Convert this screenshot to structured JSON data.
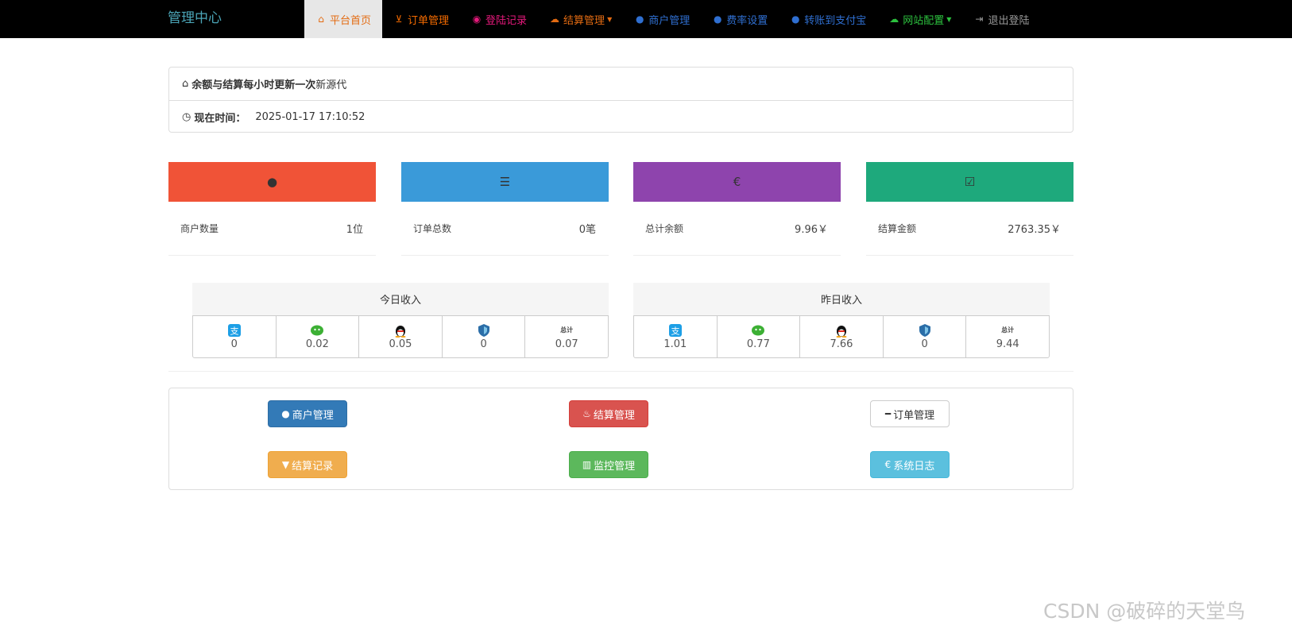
{
  "colors": {
    "nav_bg": "#000000",
    "brand": "#4ba5b7",
    "card_users": "#f05337",
    "card_orders": "#3a9ad9",
    "card_balance": "#8e44ad",
    "card_settled": "#1ea97c"
  },
  "nav": {
    "brand": "管理中心",
    "items": [
      {
        "label": "平台首页",
        "icon": "home-icon",
        "glyph": "⌂",
        "color": "#e36b12",
        "active": true
      },
      {
        "label": "订单管理",
        "icon": "cart-icon",
        "glyph": "🛒",
        "color": "#f56b00"
      },
      {
        "label": "登陆记录",
        "icon": "camera-icon",
        "glyph": "◉",
        "color": "#e5197b"
      },
      {
        "label": "结算管理",
        "icon": "cloud-icon",
        "glyph": "☁",
        "color": "#e36b12",
        "caret": true
      },
      {
        "label": "商户管理",
        "icon": "user-icon",
        "glyph": "👤",
        "color": "#2f6fd1"
      },
      {
        "label": "费率设置",
        "icon": "user-icon",
        "glyph": "👤",
        "color": "#2f6fd1"
      },
      {
        "label": "转账到支付宝",
        "icon": "user-icon",
        "glyph": "👤",
        "color": "#2f6fd1"
      },
      {
        "label": "网站配置",
        "icon": "cloud-icon",
        "glyph": "☁",
        "color": "#2cc13e",
        "caret": true
      },
      {
        "label": "退出登陆",
        "icon": "logout-icon",
        "glyph": "⇲",
        "color": "#9a9a9a"
      }
    ]
  },
  "info": {
    "notice_bold": "余额与结算每小时更新一次",
    "notice_tail": "新源代",
    "time_label": "现在时间：",
    "time_value": "2025-01-17 17:10:52"
  },
  "stats": [
    {
      "label": "商户数量",
      "value": "1位",
      "icon": "user-icon"
    },
    {
      "label": "订单总数",
      "value": "0笔",
      "icon": "list-icon"
    },
    {
      "label": "总计余额",
      "value": "9.96￥",
      "icon": "euro-icon"
    },
    {
      "label": "结算金额",
      "value": "2763.35￥",
      "icon": "check-icon"
    }
  ],
  "income": {
    "today": {
      "title": "今日收入",
      "cells": [
        {
          "icon": "alipay-icon",
          "value": "0"
        },
        {
          "icon": "wechat-icon",
          "value": "0.02"
        },
        {
          "icon": "qq-icon",
          "value": "0.05"
        },
        {
          "icon": "shield-icon",
          "value": "0"
        },
        {
          "icon": "total-icon",
          "value": "0.07",
          "icon_text": "总计"
        }
      ]
    },
    "yesterday": {
      "title": "昨日收入",
      "cells": [
        {
          "icon": "alipay-icon",
          "value": "1.01"
        },
        {
          "icon": "wechat-icon",
          "value": "0.77"
        },
        {
          "icon": "qq-icon",
          "value": "7.66"
        },
        {
          "icon": "shield-icon",
          "value": "0"
        },
        {
          "icon": "total-icon",
          "value": "9.44",
          "icon_text": "总计"
        }
      ]
    }
  },
  "buttons": [
    {
      "label": "商户管理",
      "icon": "user-icon",
      "style": "primary"
    },
    {
      "label": "结算管理",
      "icon": "fire-icon",
      "style": "danger"
    },
    {
      "label": "订单管理",
      "icon": "minus-icon",
      "style": "default"
    },
    {
      "label": "结算记录",
      "icon": "filter-icon",
      "style": "warning"
    },
    {
      "label": "监控管理",
      "icon": "barcode-icon",
      "style": "success"
    },
    {
      "label": "系统日志",
      "icon": "euro-icon",
      "style": "info"
    }
  ],
  "watermark": "CSDN @破碎的天堂鸟"
}
